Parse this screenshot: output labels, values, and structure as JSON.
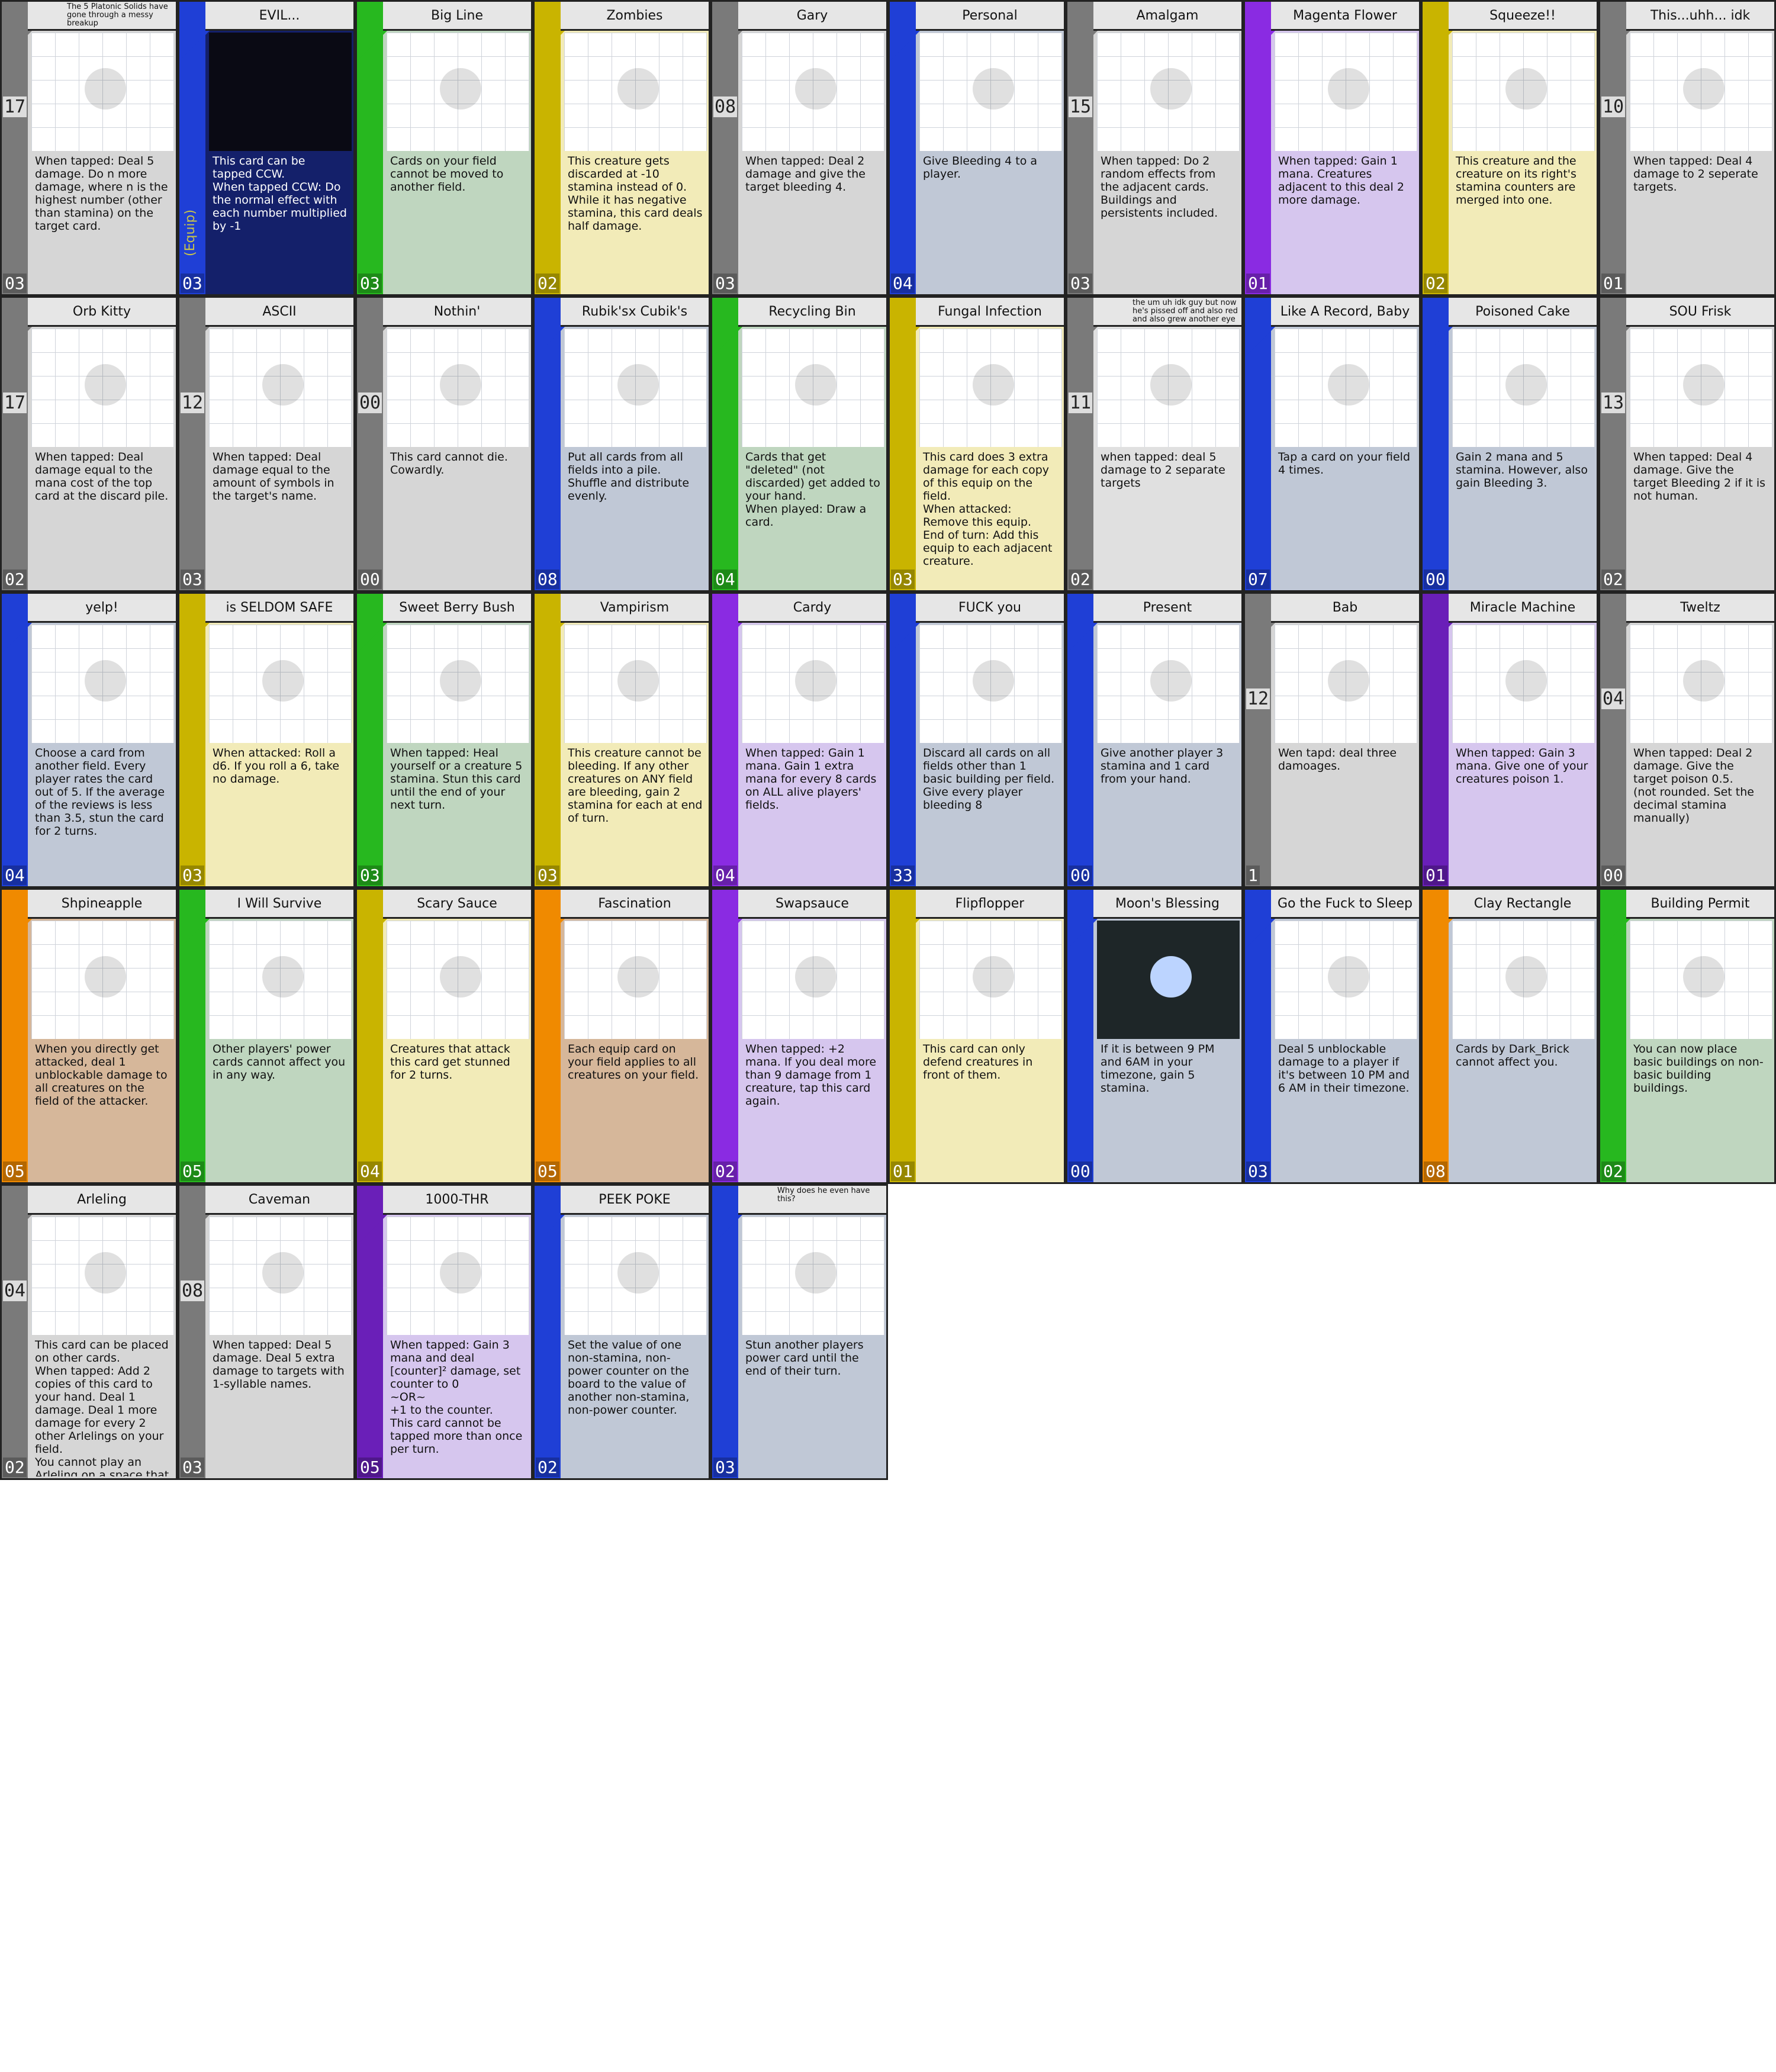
{
  "sheet_title": "",
  "cards": [
    {
      "title": "",
      "note": "The 5 Platonic Solids have gone through a messy breakup",
      "text": "When tapped: Deal 5 damage. Do n more damage, where n is the highest number (other than stamina) on the target card.",
      "cost": "03",
      "num": "17",
      "color": "#7a7a7a",
      "art_icon": "platonic-solids-icon",
      "panel": "#d6d6d6",
      "equip": ""
    },
    {
      "title": "EVIL...",
      "note": "",
      "text": "This card can be tapped CCW.\nWhen tapped CCW: Do the normal effect with each number multiplied by -1",
      "cost": "03",
      "num": "",
      "color": "#1f3fd6",
      "art_icon": "evil-face-icon",
      "panel": "#14206a",
      "equip": "(Equip)"
    },
    {
      "title": "Big Line",
      "note": "",
      "text": "Cards on your field cannot be moved to another field.",
      "cost": "03",
      "num": "",
      "color": "#27b81f",
      "art_icon": "stick-figure-line-icon",
      "panel": "#bfd6bf",
      "equip": ""
    },
    {
      "title": "Zombies",
      "note": "",
      "text": "This creature gets discarded at -10 stamina instead of 0. While it has negative stamina, this card deals half damage.",
      "cost": "02",
      "num": "",
      "color": "#c9b400",
      "art_icon": "zombie-icon",
      "panel": "#f2ebb8",
      "equip": ""
    },
    {
      "title": "Gary",
      "note": "",
      "text": "When tapped: Deal 2 damage and give the target bleeding 4.",
      "cost": "03",
      "num": "08",
      "color": "#7a7a7a",
      "art_icon": "gary-icon",
      "panel": "#d6d6d6",
      "equip": ""
    },
    {
      "title": "Personal",
      "note": "",
      "text": "Give Bleeding 4 to a player.",
      "cost": "04",
      "num": "",
      "color": "#1f3fd6",
      "art_icon": "knife-figures-icon",
      "panel": "#c0c8d6",
      "equip": ""
    },
    {
      "title": "Amalgam",
      "note": "",
      "text": "When tapped: Do 2 random effects from the adjacent cards. Buildings and persistents included.",
      "cost": "03",
      "num": "15",
      "color": "#7a7a7a",
      "art_icon": "amalgam-icon",
      "panel": "#d6d6d6",
      "equip": ""
    },
    {
      "title": "Magenta Flower",
      "note": "",
      "text": "When tapped: Gain 1 mana. Creatures adjacent to this deal 2 more damage.",
      "cost": "01",
      "num": "",
      "color": "#8a2be2",
      "art_icon": "flower-icon",
      "panel": "#d6c6ee",
      "equip": ""
    },
    {
      "title": "Squeeze!!",
      "note": "",
      "text": "This creature and the creature on its right's stamina counters are merged into one.",
      "cost": "02",
      "num": "",
      "color": "#c9b400",
      "art_icon": "squeeze-box-icon",
      "panel": "#f2ebb8",
      "equip": ""
    },
    {
      "title": "This...uhh... idk",
      "note": "",
      "text": "When tapped: Deal 4 damage to 2 seperate targets.",
      "cost": "01",
      "num": "10",
      "color": "#7a7a7a",
      "art_icon": "ghost-blob-icon",
      "panel": "#d6d6d6",
      "equip": ""
    },
    {
      "title": "Orb Kitty",
      "note": "",
      "text": "When tapped: Deal damage equal to the mana cost of the top card at the discard pile.",
      "cost": "02",
      "num": "17",
      "color": "#7a7a7a",
      "art_icon": "orb-kitty-icon",
      "panel": "#d6d6d6",
      "equip": ""
    },
    {
      "title": "ASCII",
      "note": "",
      "text": "When tapped: Deal damage equal to the amount of symbols in the target's name.",
      "cost": "03",
      "num": "12",
      "color": "#7a7a7a",
      "art_icon": "ascii-cat-icon",
      "panel": "#d6d6d6",
      "equip": ""
    },
    {
      "title": "Nothin'",
      "note": "",
      "text": "This card cannot die. Cowardly.",
      "cost": "00",
      "num": "00",
      "color": "#7a7a7a",
      "art_icon": "empty-art-icon",
      "panel": "#d6d6d6",
      "equip": ""
    },
    {
      "title": "Rubik'sx Cubik's",
      "note": "",
      "text": "Put all cards from all fields into a pile. Shuffle and distribute evenly.",
      "cost": "08",
      "num": "",
      "color": "#1f3fd6",
      "art_icon": "rubiks-cube-icon",
      "panel": "#c0c8d6",
      "equip": ""
    },
    {
      "title": "Recycling Bin",
      "note": "",
      "text": "Cards that get \"deleted\" (not discarded) get added to your hand.\nWhen played: Draw a card.",
      "cost": "04",
      "num": "",
      "color": "#27b81f",
      "art_icon": "recycling-bin-icon",
      "panel": "#bfd6bf",
      "equip": ""
    },
    {
      "title": "Fungal Infection",
      "note": "",
      "text": "This card does 3 extra damage for each copy of this equip on the field.\nWhen attacked: Remove this equip.\nEnd of turn: Add this equip to each adjacent creature.",
      "cost": "03",
      "num": "",
      "color": "#c9b400",
      "art_icon": "mushrooms-icon",
      "panel": "#f2ebb8",
      "equip": ""
    },
    {
      "title": "",
      "note": "the um uh idk guy but now he's pissed off and also red and also grew another eye",
      "text": "when tapped: deal 5 damage to 2 separate targets",
      "cost": "02",
      "num": "11",
      "color": "#7a7a7a",
      "art_icon": "red-creature-icon",
      "panel": "#e0e0e0",
      "equip": ""
    },
    {
      "title": "Like A Record, Baby",
      "note": "",
      "text": "Tap a card on your field 4 times.",
      "cost": "07",
      "num": "",
      "color": "#1f3fd6",
      "art_icon": "record-icon",
      "panel": "#c0c8d6",
      "equip": ""
    },
    {
      "title": "Poisoned Cake",
      "note": "",
      "text": "Gain 2 mana and 5 stamina. However, also gain Bleeding 3.",
      "cost": "00",
      "num": "",
      "color": "#1f3fd6",
      "art_icon": "cake-icon",
      "panel": "#c0c8d6",
      "equip": ""
    },
    {
      "title": "SOU Frisk",
      "note": "",
      "text": "When tapped: Deal 4 damage. Give the target Bleeding 2 if it is not human.",
      "cost": "02",
      "num": "13",
      "color": "#7a7a7a",
      "art_icon": "frisk-icon",
      "panel": "#d6d6d6",
      "equip": ""
    },
    {
      "title": "yelp!",
      "note": "",
      "text": "Choose a card from another field. Every player rates the card out of 5. If the average of the reviews is less than 3.5, stun the card for 2 turns.",
      "cost": "04",
      "num": "",
      "color": "#1f3fd6",
      "art_icon": "yelp-logo-icon",
      "panel": "#c0c8d6",
      "equip": ""
    },
    {
      "title": "is SELDOM SAFE",
      "note": "",
      "text": "When attacked: Roll a d6. If you roll a 6, take no damage.",
      "cost": "03",
      "num": "",
      "color": "#c9b400",
      "art_icon": "seldom-safe-icon",
      "panel": "#f2ebb8",
      "equip": ""
    },
    {
      "title": "Sweet Berry Bush",
      "note": "",
      "text": "When tapped: Heal yourself or a creature 5 stamina. Stun this card until the end of your next turn.",
      "cost": "03",
      "num": "",
      "color": "#27b81f",
      "art_icon": "berry-bush-icon",
      "panel": "#bfd6bf",
      "equip": ""
    },
    {
      "title": "Vampirism",
      "note": "",
      "text": "This creature cannot be bleeding. If any other creatures on ANY field are bleeding, gain 2 stamina for each at end of turn.",
      "cost": "03",
      "num": "",
      "color": "#c9b400",
      "art_icon": "vampire-icon",
      "panel": "#f2ebb8",
      "equip": ""
    },
    {
      "title": "Cardy",
      "note": "",
      "text": "When tapped: Gain 1 mana. Gain 1 extra mana for every 8 cards on ALL alive players' fields.",
      "cost": "04",
      "num": "",
      "color": "#8a2be2",
      "art_icon": "cardy-icon",
      "panel": "#d6c6ee",
      "equip": ""
    },
    {
      "title": "FUCK you",
      "note": "",
      "text": "Discard all cards on all fields other than 1 basic building per field. Give every player bleeding 8",
      "cost": "33",
      "num": "",
      "color": "#1f3fd6",
      "art_icon": "tiny-figure-icon",
      "panel": "#c0c8d6",
      "equip": ""
    },
    {
      "title": "Present",
      "note": "",
      "text": "Give another player 3 stamina and 1 card from your hand.",
      "cost": "00",
      "num": "",
      "color": "#1f3fd6",
      "art_icon": "present-icon",
      "panel": "#c0c8d6",
      "equip": ""
    },
    {
      "title": "Bab",
      "note": "",
      "text": "Wen tapd: deal three damoages.",
      "cost": "1",
      "num": "12",
      "color": "#7a7a7a",
      "art_icon": "bab-icon",
      "panel": "#d6d6d6",
      "equip": ""
    },
    {
      "title": "Miracle Machine",
      "note": "",
      "text": "When tapped: Gain 3 mana. Give one of your creatures poison 1.",
      "cost": "01",
      "num": "",
      "color": "#6a1fb8",
      "art_icon": "miracle-face-icon",
      "panel": "#d6c6ee",
      "equip": ""
    },
    {
      "title": "Tweltz",
      "note": "",
      "text": "When tapped: Deal 2 damage. Give the target poison 0.5.\n(not rounded. Set the decimal stamina manually)",
      "cost": "00",
      "num": "04",
      "color": "#7a7a7a",
      "art_icon": "tweltz-icon",
      "panel": "#d6d6d6",
      "equip": ""
    },
    {
      "title": "Shpineapple",
      "note": "",
      "text": "When you directly get attacked, deal 1 unblockable damage to all creatures on the field of the attacker.",
      "cost": "05",
      "num": "",
      "color": "#f08a00",
      "art_icon": "pineapple-icon",
      "panel": "#d6b79a",
      "equip": ""
    },
    {
      "title": "I Will Survive",
      "note": "",
      "text": "Other players' power cards cannot affect you in any way.",
      "cost": "05",
      "num": "",
      "color": "#27b81f",
      "art_icon": "headphones-figure-icon",
      "panel": "#bfd6bf",
      "equip": ""
    },
    {
      "title": "Scary Sauce",
      "note": "",
      "text": "Creatures that attack this card get stunned for 2 turns.",
      "cost": "04",
      "num": "",
      "color": "#c9b400",
      "art_icon": "sauce-bowl-icon",
      "panel": "#f2ebb8",
      "equip": ""
    },
    {
      "title": "Fascination",
      "note": "",
      "text": "Each equip card on your field applies to all creatures on your field.",
      "cost": "05",
      "num": "",
      "color": "#f08a00",
      "art_icon": "fire-figure-icon",
      "panel": "#d6b79a",
      "equip": ""
    },
    {
      "title": "Swapsauce",
      "note": "",
      "text": "When tapped: +2 mana. If you deal more than 9 damage from 1 creature, tap this card again.",
      "cost": "02",
      "num": "",
      "color": "#8a2be2",
      "art_icon": "mustard-bottle-icon",
      "panel": "#d6c6ee",
      "equip": ""
    },
    {
      "title": "Flipflopper",
      "note": "",
      "text": "This card can only defend creatures in front of them.",
      "cost": "01",
      "num": "",
      "color": "#c9b400",
      "art_icon": "three-figures-icon",
      "panel": "#f2ebb8",
      "equip": ""
    },
    {
      "title": "Moon's Blessing",
      "note": "",
      "text": "If it is between 9 PM and 6AM in your timezone, gain 5 stamina.",
      "cost": "00",
      "num": "",
      "color": "#1f3fd6",
      "art_icon": "moon-icon",
      "panel": "#c0c8d6",
      "equip": ""
    },
    {
      "title": "Go the Fuck to Sleep",
      "note": "",
      "text": "Deal 5 unblockable damage to a player if it's between 10 PM and 6 AM in their timezone.",
      "cost": "03",
      "num": "",
      "color": "#1f3fd6",
      "art_icon": "cat-box-icon",
      "panel": "#c0c8d6",
      "equip": ""
    },
    {
      "title": "Clay Rectangle",
      "note": "",
      "text": "Cards by Dark_Brick cannot affect you.",
      "cost": "08",
      "num": "",
      "color": "#f08a00",
      "art_icon": "clay-rectangle-icon",
      "panel": "#c0c8d6",
      "equip": ""
    },
    {
      "title": "Building Permit",
      "note": "",
      "text": "You can now place basic buildings on non-basic building buildings.",
      "cost": "02",
      "num": "",
      "color": "#27b81f",
      "art_icon": "building-permit-icon",
      "panel": "#bfd6bf",
      "equip": ""
    },
    {
      "title": "Arleling",
      "note": "",
      "text": "This card can be placed on other cards.\nWhen tapped: Add 2 copies of this card to your hand. Deal 1 damage. Deal 1 more damage for every 2 other Arlelings on your field.\nYou cannot play an Arleling on a space that has another Arleling.",
      "cost": "02",
      "num": "04",
      "color": "#7a7a7a",
      "art_icon": "tiny-arleling-icon",
      "panel": "#d6d6d6",
      "equip": ""
    },
    {
      "title": "Caveman",
      "note": "",
      "text": "When tapped: Deal 5 damage. Deal 5 extra damage to targets with 1-syllable names.",
      "cost": "03",
      "num": "08",
      "color": "#7a7a7a",
      "art_icon": "caveman-icon",
      "panel": "#d6d6d6",
      "equip": ""
    },
    {
      "title": "1000-THR",
      "note": "",
      "text": "When tapped: Gain 3 mana and deal [counter]² damage, set counter to 0\n~OR~\n+1 to the counter.\nThis card cannot be tapped more than once per turn.",
      "cost": "05",
      "num": "",
      "color": "#6a1fb8",
      "art_icon": "robot-tower-icon",
      "panel": "#d6c6ee",
      "equip": ""
    },
    {
      "title": "PEEK POKE",
      "note": "",
      "text": "Set the value of one non-stamina, non-power counter on the board to the value of another non-stamina, non-power counter.",
      "cost": "02",
      "num": "",
      "color": "#1f3fd6",
      "art_icon": "peek-poke-icon",
      "panel": "#c0c8d6",
      "equip": ""
    },
    {
      "title": "",
      "note": "Why does he even have this?",
      "text": "Stun another players power card until the end of their turn.",
      "cost": "03",
      "num": "",
      "color": "#1f3fd6",
      "art_icon": "hammer-figure-icon",
      "panel": "#c0c8d6",
      "equip": ""
    }
  ]
}
